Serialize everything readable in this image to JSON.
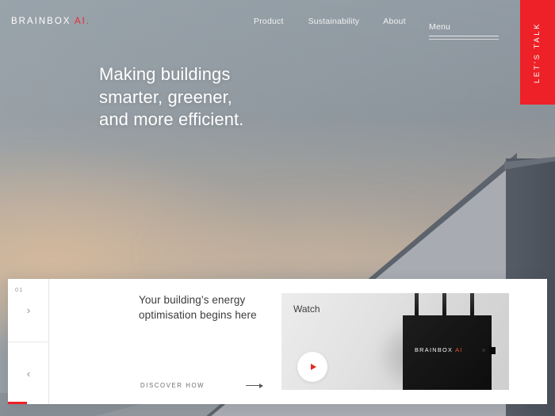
{
  "brand": {
    "name": "BRAINBOX",
    "suffix": "AI.",
    "accent_color": "#ed2939"
  },
  "nav": {
    "links": [
      {
        "label": "Product",
        "name": "nav-link-product"
      },
      {
        "label": "Sustainability",
        "name": "nav-link-sustainability"
      },
      {
        "label": "About",
        "name": "nav-link-about"
      }
    ],
    "menu_label": "Menu"
  },
  "cta": {
    "lets_talk": "LET'S TALK",
    "color": "#ed2127"
  },
  "hero": {
    "headline_line1": "Making buildings",
    "headline_line2": "smarter, greener,",
    "headline_line3": "and more efficient."
  },
  "slider": {
    "slide_number": "01",
    "next_icon": "›",
    "prev_icon": "‹",
    "progress_color": "#ed2127",
    "slide": {
      "title_line1": "Your building’s energy",
      "title_line2": "optimisation begins here",
      "cta_label": "DISCOVER HOW"
    }
  },
  "watch_card": {
    "label": "Watch",
    "device_brand": "BRAINBOX",
    "device_brand_accent": "AI",
    "play_color": "#e02b20"
  }
}
